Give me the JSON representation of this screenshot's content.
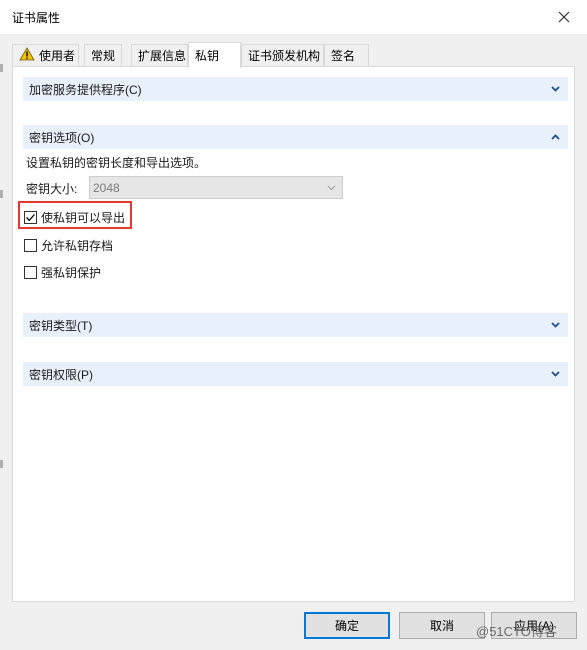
{
  "window": {
    "title": "证书属性",
    "close_icon": "close-icon"
  },
  "tabs": [
    {
      "label": "使用者",
      "icon": "warning-icon",
      "active": false
    },
    {
      "label": "常规",
      "active": false
    },
    {
      "label": "扩展信息",
      "active": false
    },
    {
      "label": "私钥",
      "active": true
    },
    {
      "label": "证书颁发机构",
      "active": false
    },
    {
      "label": "签名",
      "active": false
    }
  ],
  "sections": {
    "csp": {
      "label": "加密服务提供程序(C)",
      "expanded": false
    },
    "key_options": {
      "label": "密钥选项(O)",
      "expanded": true,
      "description": "设置私钥的密钥长度和导出选项。",
      "key_size_label": "密钥大小:",
      "key_size_value": "2048",
      "checkboxes": [
        {
          "label": "使私钥可以导出",
          "checked": true
        },
        {
          "label": "允许私钥存档",
          "checked": false
        },
        {
          "label": "强私钥保护",
          "checked": false
        }
      ]
    },
    "key_type": {
      "label": "密钥类型(T)",
      "expanded": false
    },
    "key_permissions": {
      "label": "密钥权限(P)",
      "expanded": false
    }
  },
  "buttons": {
    "ok": "确定",
    "cancel": "取消",
    "apply": "应用(A)"
  },
  "watermark": "@51CTO博客",
  "colors": {
    "section_bg": "#e8f1fb",
    "highlight": "#e53935",
    "default_button_border": "#0078d7",
    "chevron": "#1f4e8c"
  }
}
